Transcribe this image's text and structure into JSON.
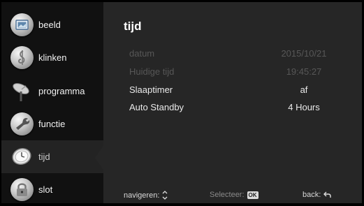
{
  "sidebar": {
    "items": [
      {
        "label": "beeld",
        "icon": "picture-icon"
      },
      {
        "label": "klinken",
        "icon": "music-note-icon"
      },
      {
        "label": "programma",
        "icon": "satellite-dish-icon"
      },
      {
        "label": "functie",
        "icon": "wrench-icon"
      },
      {
        "label": "tijd",
        "icon": "clock-icon",
        "selected": true
      },
      {
        "label": "slot",
        "icon": "padlock-icon"
      }
    ]
  },
  "main": {
    "title": "tijd",
    "rows": [
      {
        "label": "datum",
        "value": "2015/10/21",
        "state": "disabled"
      },
      {
        "label": "Huidige tijd",
        "value": "19:45:27",
        "state": "disabled"
      },
      {
        "label": "Slaaptimer",
        "value": "af",
        "state": "active"
      },
      {
        "label": "Auto Standby",
        "value": "4 Hours",
        "state": "active"
      }
    ]
  },
  "footer": {
    "navigate_label": "navigeren:",
    "navigate_icon": "up-down-arrows-icon",
    "select_label": "Selecteer:",
    "select_key": "OK",
    "back_label": "back:",
    "back_icon": "return-arrow-icon"
  },
  "colors": {
    "background": "#262626",
    "sidebar": "#111111",
    "selected_item": "#232323",
    "disabled_text": "#575757",
    "active_text": "#eaeaea"
  }
}
